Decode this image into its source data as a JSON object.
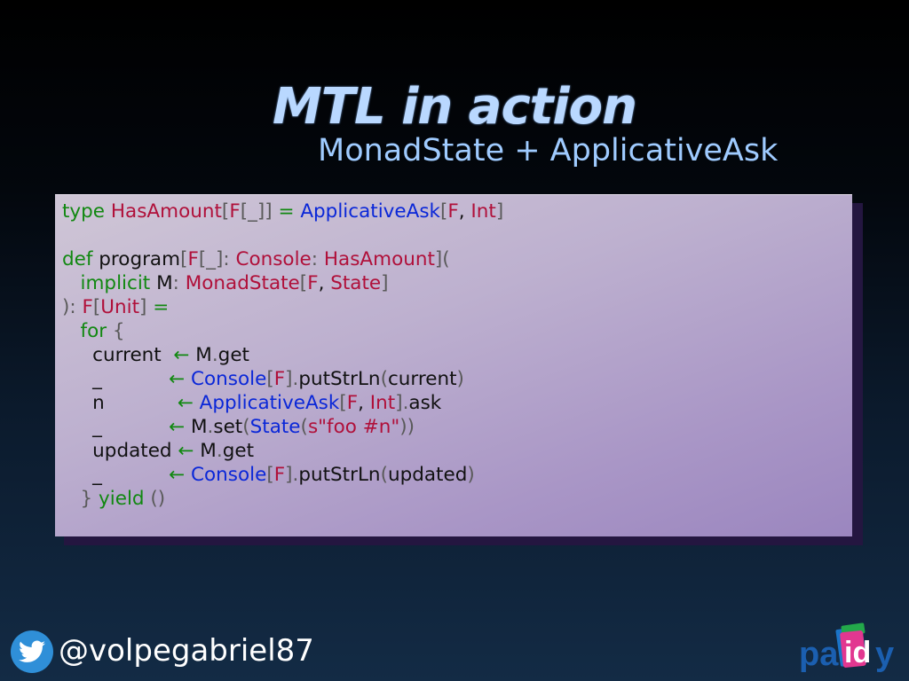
{
  "slide": {
    "title": "MTL in action",
    "subtitle": "MonadState + ApplicativeAsk",
    "handle": "@volpegabriel87",
    "logo_text": "paidy",
    "icons": [
      "twitter-icon",
      "paidy-logo"
    ]
  },
  "code_lines": [
    [
      [
        "type ",
        "kw"
      ],
      [
        "HasAmount",
        "ty"
      ],
      [
        "[",
        "pn"
      ],
      [
        "F",
        "ty"
      ],
      [
        "[_]",
        "pn"
      ],
      [
        "] ",
        "pn"
      ],
      [
        "= ",
        "op"
      ],
      [
        "ApplicativeAsk",
        "tyb"
      ],
      [
        "[",
        "pn"
      ],
      [
        "F",
        "ty"
      ],
      [
        ", ",
        "id"
      ],
      [
        "Int",
        "ty"
      ],
      [
        "]",
        "pn"
      ]
    ],
    [],
    [
      [
        "def ",
        "kw"
      ],
      [
        "program",
        "id"
      ],
      [
        "[",
        "pn"
      ],
      [
        "F",
        "ty"
      ],
      [
        "[_]: ",
        "pn"
      ],
      [
        "Console",
        "ty"
      ],
      [
        ": ",
        "pn"
      ],
      [
        "HasAmount",
        "ty"
      ],
      [
        "](",
        "pn"
      ]
    ],
    [
      [
        "   implicit ",
        "kw"
      ],
      [
        "M",
        "id"
      ],
      [
        ": ",
        "pn"
      ],
      [
        "MonadState",
        "ty"
      ],
      [
        "[",
        "pn"
      ],
      [
        "F",
        "ty"
      ],
      [
        ", ",
        "id"
      ],
      [
        "State",
        "ty"
      ],
      [
        "]",
        "pn"
      ]
    ],
    [
      [
        "): ",
        "pn"
      ],
      [
        "F",
        "ty"
      ],
      [
        "[",
        "pn"
      ],
      [
        "Unit",
        "ty"
      ],
      [
        "] ",
        "pn"
      ],
      [
        "=",
        "op"
      ]
    ],
    [
      [
        "   for ",
        "kw"
      ],
      [
        "{",
        "pn"
      ]
    ],
    [
      [
        "     current  ",
        "id"
      ],
      [
        "← ",
        "op"
      ],
      [
        "M",
        "id"
      ],
      [
        ".",
        "pn"
      ],
      [
        "get",
        "id"
      ]
    ],
    [
      [
        "     _           ",
        "id"
      ],
      [
        "← ",
        "op"
      ],
      [
        "Console",
        "tyb"
      ],
      [
        "[",
        "pn"
      ],
      [
        "F",
        "ty"
      ],
      [
        "]",
        "pn"
      ],
      [
        ".",
        "pn"
      ],
      [
        "putStrLn",
        "id"
      ],
      [
        "(",
        "pn"
      ],
      [
        "current",
        "id"
      ],
      [
        ")",
        "pn"
      ]
    ],
    [
      [
        "     n            ",
        "id"
      ],
      [
        "← ",
        "op"
      ],
      [
        "ApplicativeAsk",
        "tyb"
      ],
      [
        "[",
        "pn"
      ],
      [
        "F",
        "ty"
      ],
      [
        ", ",
        "id"
      ],
      [
        "Int",
        "ty"
      ],
      [
        "]",
        "pn"
      ],
      [
        ".",
        "pn"
      ],
      [
        "ask",
        "id"
      ]
    ],
    [
      [
        "     _           ",
        "id"
      ],
      [
        "← ",
        "op"
      ],
      [
        "M",
        "id"
      ],
      [
        ".",
        "pn"
      ],
      [
        "set",
        "id"
      ],
      [
        "(",
        "pn"
      ],
      [
        "State",
        "tyb"
      ],
      [
        "(",
        "pn"
      ],
      [
        "s\"foo #n\"",
        "st"
      ],
      [
        "))",
        "pn"
      ]
    ],
    [
      [
        "     updated ",
        "id"
      ],
      [
        "← ",
        "op"
      ],
      [
        "M",
        "id"
      ],
      [
        ".",
        "pn"
      ],
      [
        "get",
        "id"
      ]
    ],
    [
      [
        "     _           ",
        "id"
      ],
      [
        "← ",
        "op"
      ],
      [
        "Console",
        "tyb"
      ],
      [
        "[",
        "pn"
      ],
      [
        "F",
        "ty"
      ],
      [
        "]",
        "pn"
      ],
      [
        ".",
        "pn"
      ],
      [
        "putStrLn",
        "id"
      ],
      [
        "(",
        "pn"
      ],
      [
        "updated",
        "id"
      ],
      [
        ")",
        "pn"
      ]
    ],
    [
      [
        "   } ",
        "pn"
      ],
      [
        "yield ",
        "kw"
      ],
      [
        "()",
        "pn"
      ]
    ]
  ]
}
